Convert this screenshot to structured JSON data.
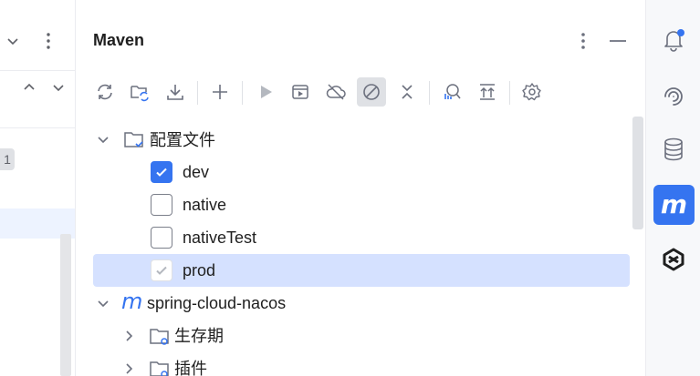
{
  "left_strip": {
    "line_number": "1"
  },
  "panel": {
    "title": "Maven",
    "header_buttons": [
      "more-vertical-icon",
      "minimize-icon"
    ],
    "toolbar": [
      "reload-all-icon",
      "reload-generate-icon",
      "download-icon",
      "add-icon",
      "run-icon",
      "execute-goal-icon",
      "offline-mode-icon",
      "skip-tests-icon",
      "collapse-all-icon",
      "analyze-dependencies-icon",
      "show-dependencies-icon",
      "settings-icon"
    ],
    "toolbar_active": "skip-tests-icon"
  },
  "tree": {
    "profiles_label": "配置文件",
    "profiles": [
      {
        "label": "dev",
        "checked": true
      },
      {
        "label": "native",
        "checked": false
      },
      {
        "label": "nativeTest",
        "checked": false
      },
      {
        "label": "prod",
        "checked": true,
        "disabled": true,
        "selected": true
      }
    ],
    "project_label": "spring-cloud-nacos",
    "project_icon_letter": "m",
    "children": [
      {
        "label": "生存期"
      },
      {
        "label": "插件"
      }
    ]
  },
  "right_strip": {
    "tools": [
      "notifications-icon",
      "ai-assistant-icon",
      "database-icon",
      "maven-icon",
      "app-logo-icon"
    ],
    "active": "maven-icon",
    "maven_letter": "m",
    "accent": "#3574f0"
  }
}
